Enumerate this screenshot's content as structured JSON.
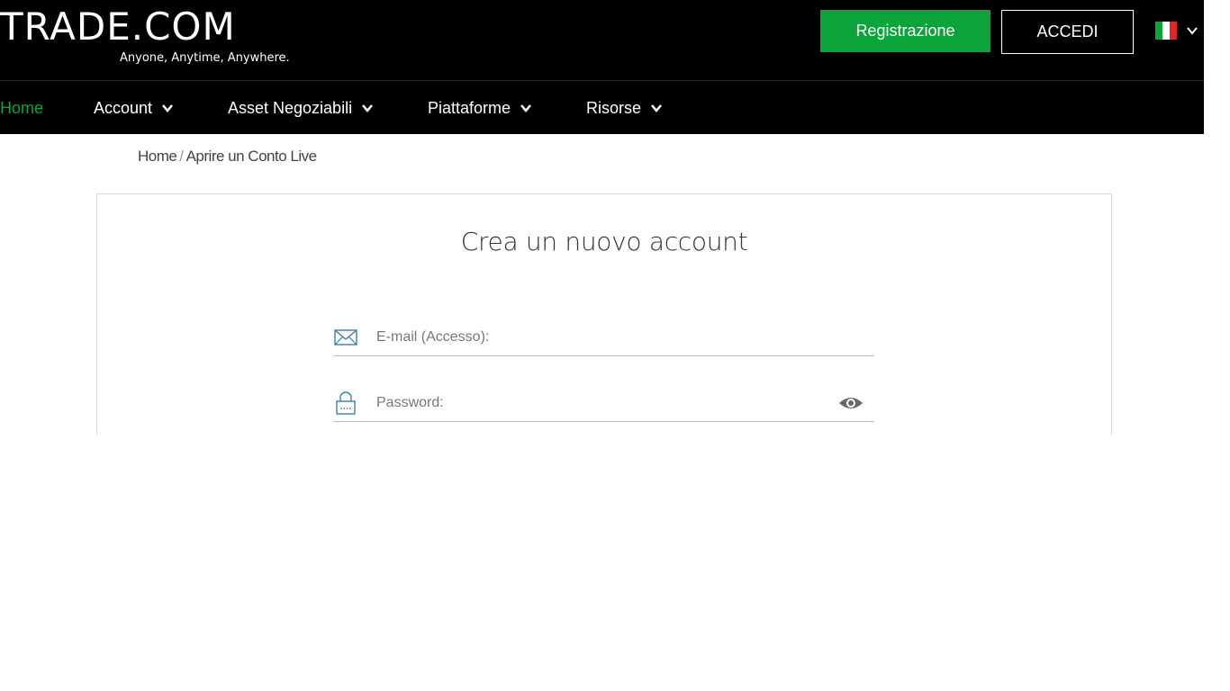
{
  "header": {
    "logo_text": "TRADE.COM",
    "tagline": "Anyone, Anytime, Anywhere.",
    "register_label": "Registrazione",
    "login_label": "ACCEDI",
    "language_flag": "italy-flag",
    "colors": {
      "background": "#000000",
      "accent": "#0aa43b",
      "text": "#ffffff"
    }
  },
  "nav": {
    "items": [
      {
        "label": "Home",
        "active": true,
        "has_dropdown": false
      },
      {
        "label": "Account",
        "active": false,
        "has_dropdown": true
      },
      {
        "label": "Asset Negoziabili",
        "active": false,
        "has_dropdown": true
      },
      {
        "label": "Piattaforme",
        "active": false,
        "has_dropdown": true
      },
      {
        "label": "Risorse",
        "active": false,
        "has_dropdown": true
      }
    ]
  },
  "breadcrumb": {
    "home": "Home",
    "separator": "/",
    "current": "Aprire un Conto Live"
  },
  "form": {
    "title": "Crea un nuovo account",
    "email": {
      "placeholder": "E-mail (Accesso):",
      "value": "",
      "icon": "envelope-icon"
    },
    "password": {
      "placeholder": "Password:",
      "value": "",
      "icon": "lock-icon",
      "toggle_icon": "eye-icon"
    }
  }
}
